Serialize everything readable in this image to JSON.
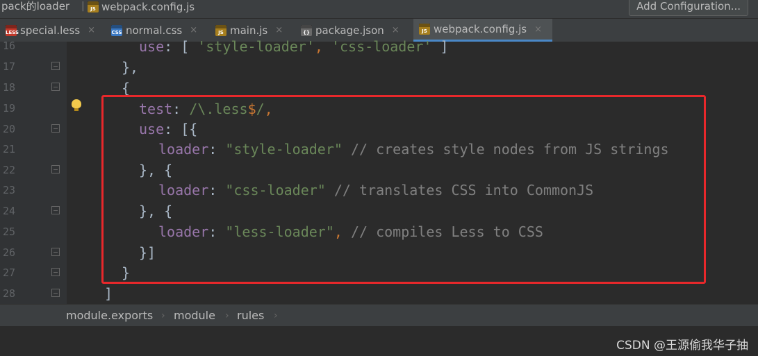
{
  "topbar": {
    "crumb_project": "pack的loader",
    "crumb_file": "webpack.config.js",
    "crumb_file_icon": "JS",
    "add_configuration": "Add Configuration..."
  },
  "tabs": [
    {
      "label": "special.less",
      "icon": "LESS",
      "close": "×"
    },
    {
      "label": "normal.css",
      "icon": "CSS",
      "close": "×"
    },
    {
      "label": "main.js",
      "icon": "JS",
      "close": "×"
    },
    {
      "label": "package.json",
      "icon": "{}",
      "close": "×"
    },
    {
      "label": "webpack.config.js",
      "icon": "JS",
      "close": "×",
      "active": true
    }
  ],
  "editor": {
    "line_numbers": [
      "16",
      "17",
      "18",
      "19",
      "20",
      "21",
      "22",
      "23",
      "24",
      "25",
      "26",
      "27",
      "28"
    ],
    "lines": {
      "l16": {
        "kw": "use",
        "rest": ": [ ",
        "s1": "'style-loader'",
        "sep": ", ",
        "s2": "'css-loader'",
        "end": " ]"
      },
      "l17": {
        "text": "},"
      },
      "l18": {
        "text": "{"
      },
      "l19": {
        "kw": "test",
        "colon": ": ",
        "re1": "/\\.less",
        "re2": "$",
        "re3": "/",
        "comma": ","
      },
      "l20": {
        "kw": "use",
        "rest": ": [{"
      },
      "l21": {
        "kw": "loader",
        "colon": ": ",
        "str": "\"style-loader\"",
        "comment": " // creates style nodes from JS strings"
      },
      "l22": {
        "text": "}, {"
      },
      "l23": {
        "kw": "loader",
        "colon": ": ",
        "str": "\"css-loader\"",
        "comment": " // translates CSS into CommonJS"
      },
      "l24": {
        "text": "}, {"
      },
      "l25": {
        "kw": "loader",
        "colon": ": ",
        "str": "\"less-loader\"",
        "comma": ",",
        "comment": " // compiles Less to CSS"
      },
      "l26": {
        "text": "}]"
      },
      "l27": {
        "text": "}"
      },
      "l28": {
        "text": "]"
      }
    }
  },
  "breadcrumb": {
    "items": [
      "module.exports",
      "module",
      "rules"
    ],
    "sep": "›"
  },
  "watermark": "CSDN @王源偷我华子抽",
  "colors": {
    "highlight_box": "#e8282b",
    "keyword": "#9876aa",
    "string": "#6a8759",
    "comment": "#808080",
    "punct": "#cc7832"
  }
}
